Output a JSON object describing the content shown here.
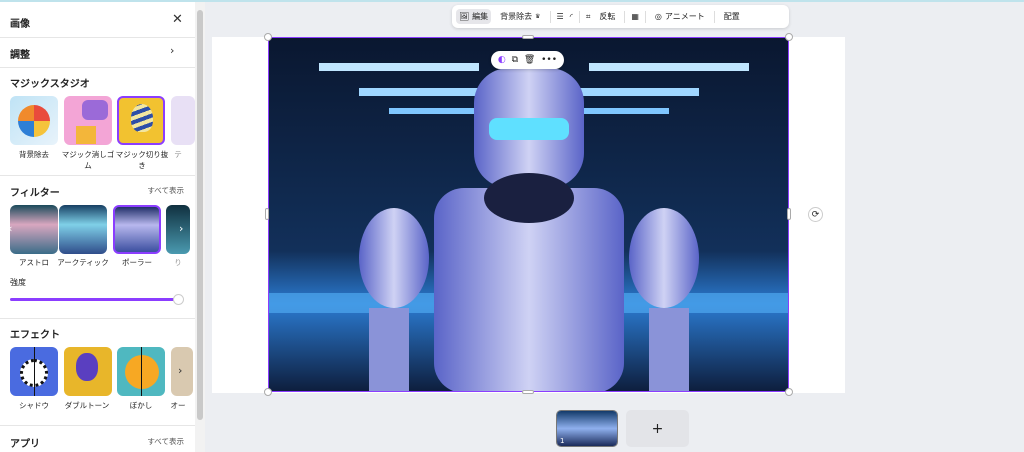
{
  "panel": {
    "title": "画像",
    "adjust": "調整",
    "magic_studio": {
      "title": "マジックスタジオ",
      "items": [
        {
          "label": "背景除去"
        },
        {
          "label": "マジック消しゴム"
        },
        {
          "label": "マジック切り抜き"
        },
        {
          "label": "テ"
        }
      ]
    },
    "filters": {
      "title": "フィルター",
      "see_all": "すべて表示",
      "items": [
        {
          "label": "アストロ"
        },
        {
          "label": "アークティック"
        },
        {
          "label": "ポーラー",
          "selected": true
        },
        {
          "label": "り"
        }
      ],
      "intensity_label": "強度",
      "intensity": 1.0
    },
    "effects": {
      "title": "エフェクト",
      "items": [
        {
          "label": "シャドウ"
        },
        {
          "label": "ダブルトーン"
        },
        {
          "label": "ぼかし"
        },
        {
          "label": "オー"
        }
      ]
    },
    "apps": {
      "title": "アプリ",
      "see_all": "すべて表示"
    }
  },
  "toolbar": {
    "edit": "編集",
    "bg_remove": "背景除去",
    "flip": "反転",
    "animate": "アニメート",
    "position": "配置"
  },
  "pages": {
    "current_page": "1",
    "add": "+"
  },
  "colors": {
    "accent": "#8b3dff"
  }
}
